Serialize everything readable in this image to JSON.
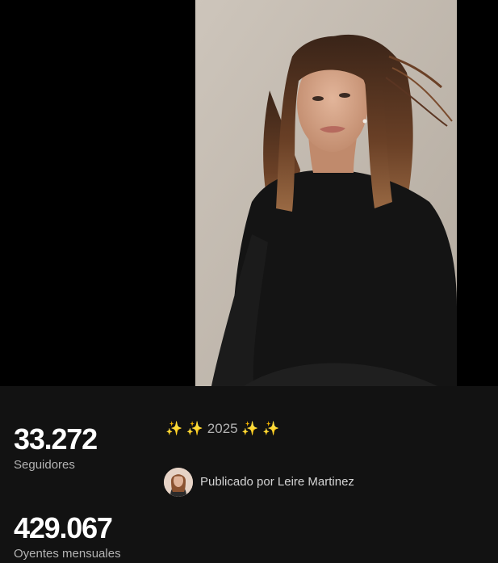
{
  "stats": {
    "followers": {
      "value": "33.272",
      "label": "Seguidores"
    },
    "monthly_listeners": {
      "value": "429.067",
      "label": "Oyentes mensuales"
    }
  },
  "bio": {
    "text": "✨ ✨ 2025 ✨ ✨"
  },
  "author": {
    "label": "Publicado por Leire Martinez"
  },
  "colors": {
    "page_background": "#000000",
    "panel_background": "#121212",
    "primary_text": "#ffffff",
    "secondary_text": "#b3b3b3",
    "photo_backdrop": "#c5bcb2"
  }
}
